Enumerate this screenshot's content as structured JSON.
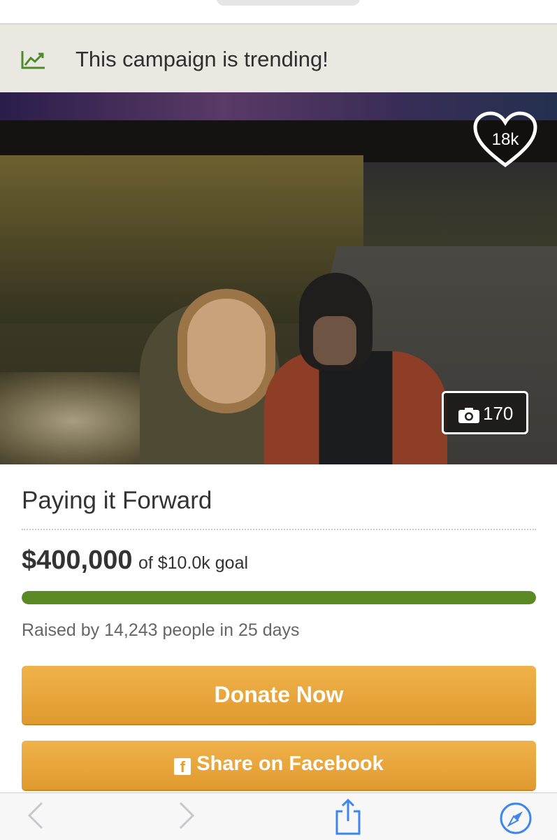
{
  "banner": {
    "text": "This campaign is trending!",
    "icon": "trending-chart-icon"
  },
  "photo": {
    "hearts_count": "18k",
    "photo_count": "170"
  },
  "campaign": {
    "title": "Paying it Forward",
    "raised_amount": "$400,000",
    "goal_text": "of $10.0k goal",
    "progress_fraction": 1.0,
    "raised_by": "Raised by 14,243 people in 25 days"
  },
  "buttons": {
    "donate_label": "Donate Now",
    "share_label": "Share on Facebook"
  },
  "toolbar": {
    "icons": [
      "back-icon",
      "forward-icon",
      "share-icon",
      "compass-icon"
    ]
  },
  "colors": {
    "accent_green": "#5b8a25",
    "button_orange": "#e9a63c",
    "banner_bg": "#eae9e1",
    "trend_icon": "#4f8a2a",
    "toolbar_blue": "#3d86f0"
  }
}
